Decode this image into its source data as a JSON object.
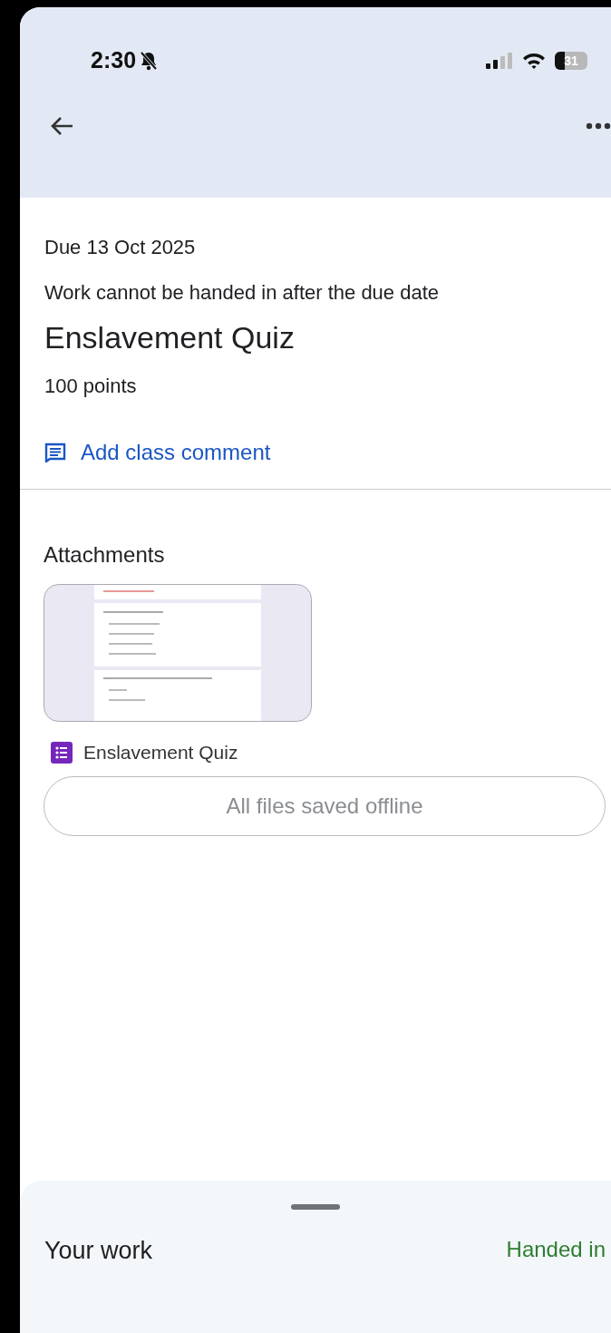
{
  "status_bar": {
    "time": "2:30",
    "battery": "31"
  },
  "assignment": {
    "due": "Due 13 Oct 2025",
    "note": "Work cannot be handed in after the due date",
    "title": "Enslavement Quiz",
    "points": "100 points",
    "comment_link": "Add class comment"
  },
  "attachments": {
    "heading": "Attachments",
    "items": [
      {
        "name": "Enslavement Quiz",
        "kind": "form"
      }
    ],
    "offline_button": "All files saved offline"
  },
  "your_work": {
    "label": "Your work",
    "status": "Handed in"
  }
}
